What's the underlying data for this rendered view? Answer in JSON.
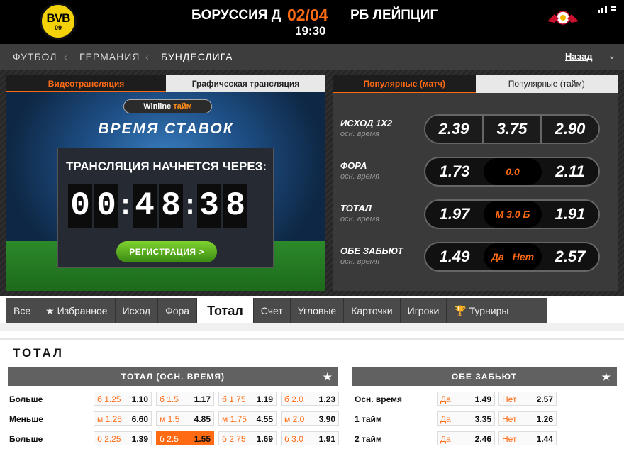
{
  "header": {
    "home_team": "БОРУССИЯ Д",
    "score": "02/04",
    "away_team": "РБ ЛЕЙПЦИГ",
    "time": "19:30",
    "home_logo_text": "BVB",
    "home_logo_sub": "09"
  },
  "breadcrumb": {
    "items": [
      "ФУТБОЛ",
      "ГЕРМАНИЯ",
      "БУНДЕСЛИГА"
    ],
    "back": "Назад"
  },
  "video": {
    "tab_active": "Видеотрансляция",
    "tab_other": "Графическая трансляция",
    "brand": "Winline",
    "brand_suffix": "тайм",
    "banner": "ВРЕМЯ СТАВОК",
    "countdown_title": "ТРАНСЛЯЦИЯ НАЧНЕТСЯ ЧЕРЕЗ:",
    "digits": [
      "0",
      "0",
      "4",
      "8",
      "3",
      "8"
    ],
    "register": "РЕГИСТРАЦИЯ >"
  },
  "popular": {
    "tab_active": "Популярные (матч)",
    "tab_other": "Популярные (тайм)",
    "rows": [
      {
        "label": "ИСХОД 1Х2",
        "sub": "осн. время",
        "left": "2.39",
        "mid": "3.75",
        "right": "2.90"
      },
      {
        "label": "ФОРА",
        "sub": "осн. время",
        "left": "1.73",
        "mid": "0.0",
        "right": "2.11"
      },
      {
        "label": "ТОТАЛ",
        "sub": "осн. время",
        "left": "1.97",
        "mid": "М 3.0 Б",
        "right": "1.91"
      },
      {
        "label": "ОБЕ ЗАБЬЮТ",
        "sub": "осн. время",
        "left": "1.49",
        "mid_a": "Да",
        "mid_b": "Нет",
        "right": "2.57"
      }
    ]
  },
  "categories": [
    "Все",
    "★ Избранное",
    "Исход",
    "Фора",
    "Тотал",
    "Счет",
    "Угловые",
    "Карточки",
    "Игроки",
    "Турниры"
  ],
  "section_title": "ТОТАЛ",
  "total_block": {
    "title": "ТОТАЛ (ОСН. ВРЕМЯ)",
    "rows": [
      {
        "label": "Больше",
        "cells": [
          [
            "б 1.25",
            "1.10"
          ],
          [
            "б 1.5",
            "1.17"
          ],
          [
            "б 1.75",
            "1.19"
          ],
          [
            "б 2.0",
            "1.23"
          ]
        ]
      },
      {
        "label": "Меньше",
        "cells": [
          [
            "м 1.25",
            "6.60"
          ],
          [
            "м 1.5",
            "4.85"
          ],
          [
            "м 1.75",
            "4.55"
          ],
          [
            "м 2.0",
            "3.90"
          ]
        ]
      },
      {
        "label": "Больше",
        "cells": [
          [
            "б 2.25",
            "1.39"
          ],
          [
            "б 2.5",
            "1.55"
          ],
          [
            "б 2.75",
            "1.69"
          ],
          [
            "б 3.0",
            "1.91"
          ]
        ]
      }
    ]
  },
  "both_block": {
    "title": "ОБЕ ЗАБЬЮТ",
    "rows": [
      {
        "label": "Осн. время",
        "yes": [
          "Да",
          "1.49"
        ],
        "no": [
          "Нет",
          "2.57"
        ]
      },
      {
        "label": "1 тайм",
        "yes": [
          "Да",
          "3.35"
        ],
        "no": [
          "Нет",
          "1.26"
        ]
      },
      {
        "label": "2 тайм",
        "yes": [
          "Да",
          "2.46"
        ],
        "no": [
          "Нет",
          "1.44"
        ]
      }
    ]
  },
  "colors": {
    "accent": "#ff6a13",
    "header_bg": "#000000",
    "bar_bg": "#616161"
  }
}
